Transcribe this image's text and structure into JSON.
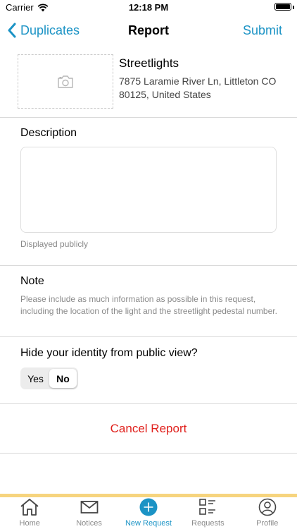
{
  "status_bar": {
    "carrier": "Carrier",
    "time": "12:18 PM"
  },
  "nav": {
    "back_label": "Duplicates",
    "title": "Report",
    "submit_label": "Submit"
  },
  "service": {
    "name": "Streetlights",
    "address": "7875 Laramie River Ln, Littleton CO 80125, United States",
    "photo_icon": "camera-icon"
  },
  "description": {
    "heading": "Description",
    "value": "",
    "placeholder": "",
    "hint": "Displayed publicly"
  },
  "note": {
    "heading": "Note",
    "body": "Please include as much information as possible in this request, including the location of the light and the streetlight pedestal number."
  },
  "identity": {
    "question": "Hide your identity from public view?",
    "yes_label": "Yes",
    "no_label": "No",
    "selected": "No"
  },
  "cancel": {
    "label": "Cancel Report"
  },
  "tabs": [
    {
      "label": "Home",
      "icon": "house-icon"
    },
    {
      "label": "Notices",
      "icon": "envelope-icon"
    },
    {
      "label": "New Request",
      "icon": "plus-circle-icon",
      "active": true
    },
    {
      "label": "Requests",
      "icon": "list-icon"
    },
    {
      "label": "Profile",
      "icon": "person-circle-icon"
    }
  ],
  "colors": {
    "accent": "#1b93c5",
    "danger": "#e0201c",
    "tab_strip": "#f6d47e"
  }
}
